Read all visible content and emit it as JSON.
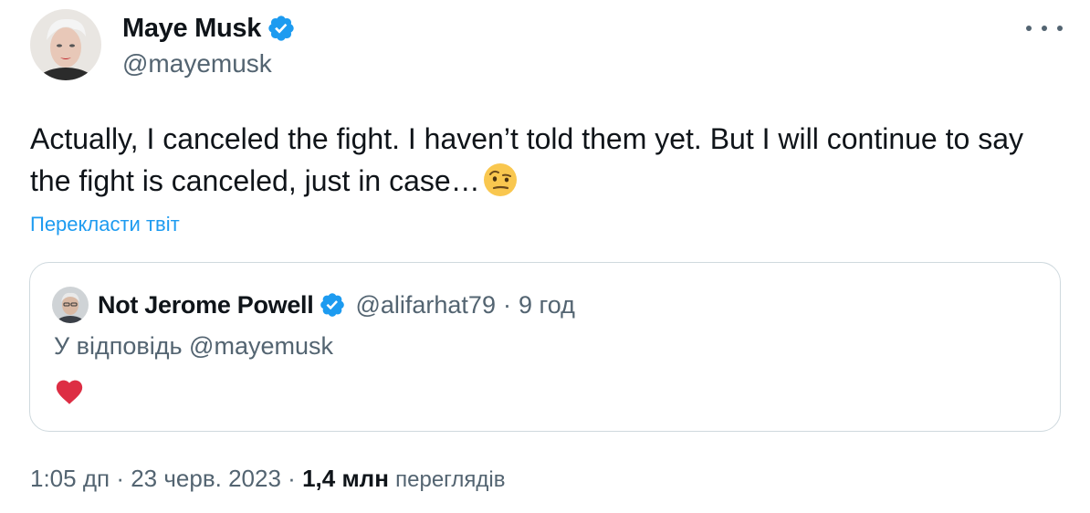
{
  "author": {
    "name": "Maye Musk",
    "handle": "@mayemusk",
    "verified": true
  },
  "tweet": {
    "text": "Actually, I canceled the fight. I haven’t told them yet. But I will continue to say the fight is canceled, just in case…",
    "emoji": "face-with-raised-eyebrow-icon",
    "translate_label": "Перекласти твіт"
  },
  "quote": {
    "name": "Not Jerome Powell",
    "handle": "@alifarhat79",
    "separator": "·",
    "time": "9 год",
    "reply_text": "У відповідь @mayemusk",
    "content_emoji": "red-heart-icon"
  },
  "footer": {
    "time": "1:05 дп",
    "separator1": "·",
    "date": "23 черв. 2023",
    "separator2": "·",
    "views_count": "1,4 млн",
    "views_label": "переглядів"
  },
  "colors": {
    "link": "#1d9bf0",
    "secondary_text": "#536471",
    "border": "#cfd9de",
    "verified": "#1d9bf0",
    "heart": "#e0245e"
  }
}
